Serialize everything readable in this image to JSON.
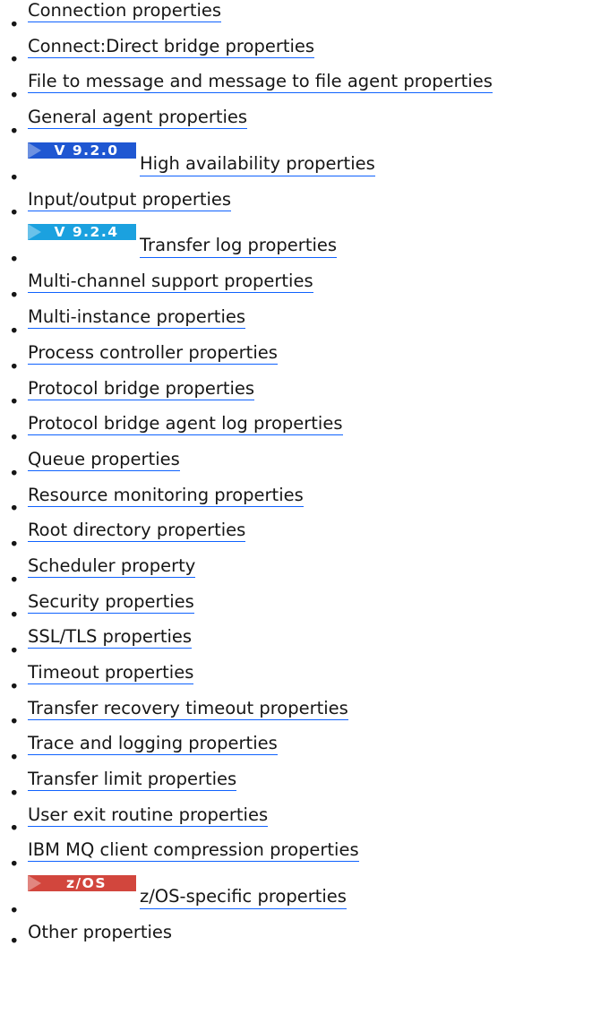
{
  "colors": {
    "link_underline": "#0f62fe",
    "text": "#161616",
    "badge_v920": "#1f57d2",
    "badge_v924": "#1ba1df",
    "badge_zos": "#d2463d"
  },
  "bullet": "•",
  "items": [
    {
      "label": "Connection properties",
      "link": true
    },
    {
      "label": "Connect:Direct bridge properties",
      "link": true
    },
    {
      "label": "File to message and message to file agent properties",
      "link": true
    },
    {
      "label": "General agent properties",
      "link": true
    },
    {
      "label": "High availability properties",
      "link": true,
      "badge": "V 9.2.0",
      "badge_icon": "version-arrow-icon"
    },
    {
      "label": "Input/output properties",
      "link": true
    },
    {
      "label": "Transfer log properties",
      "link": true,
      "badge": "V 9.2.4",
      "badge_icon": "version-arrow-icon"
    },
    {
      "label": "Multi-channel support properties",
      "link": true
    },
    {
      "label": "Multi-instance properties",
      "link": true
    },
    {
      "label": "Process controller properties",
      "link": true
    },
    {
      "label": "Protocol bridge properties",
      "link": true
    },
    {
      "label": "Protocol bridge agent log properties",
      "link": true
    },
    {
      "label": "Queue properties",
      "link": true
    },
    {
      "label": "Resource monitoring properties",
      "link": true
    },
    {
      "label": "Root directory properties",
      "link": true
    },
    {
      "label": "Scheduler property",
      "link": true
    },
    {
      "label": "Security properties",
      "link": true
    },
    {
      "label": "SSL/TLS properties",
      "link": true
    },
    {
      "label": "Timeout properties",
      "link": true
    },
    {
      "label": "Transfer recovery timeout properties",
      "link": true
    },
    {
      "label": "Trace and logging properties",
      "link": true
    },
    {
      "label": "Transfer limit properties",
      "link": true
    },
    {
      "label": "User exit routine properties",
      "link": true
    },
    {
      "label": "IBM MQ client compression properties",
      "link": true
    },
    {
      "label": "z/OS-specific properties",
      "link": true,
      "badge": "z/OS",
      "badge_icon": "platform-arrow-icon"
    },
    {
      "label": "Other properties",
      "link": false
    }
  ]
}
